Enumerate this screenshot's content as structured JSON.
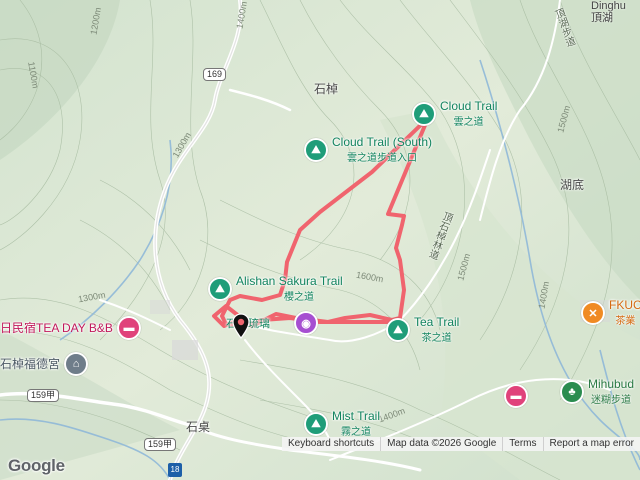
{
  "map": {
    "attribution": {
      "keyboard": "Keyboard shortcuts",
      "mapdata": "Map data ©2026 Google",
      "terms": "Terms",
      "report": "Report a map error"
    },
    "logo": "Google",
    "places": {
      "shizhao_top": "石棹",
      "shizhuo": "石桌",
      "hudi": "湖底",
      "dinghu": "Dinghu",
      "dinghu_zh": "頂湖"
    },
    "pois": {
      "cloud_trail": {
        "name": "Cloud Trail",
        "sub": "雲之道",
        "icon": "hiking-icon"
      },
      "cloud_trail_south": {
        "name": "Cloud Trail (South)",
        "sub": "雲之道步道入口",
        "icon": "hiking-icon"
      },
      "sakura_trail": {
        "name": "Alishan Sakura Trail",
        "sub": "櫻之道",
        "icon": "hiking-icon"
      },
      "tea_trail": {
        "name": "Tea Trail",
        "sub": "茶之道",
        "icon": "hiking-icon"
      },
      "mist_trail": {
        "name": "Mist Trail",
        "sub": "霧之道",
        "icon": "hiking-icon"
      },
      "bnb": {
        "name": "日民宿TEA DAY B&B",
        "icon": "lodging-icon"
      },
      "temple": {
        "name": "石棹福德宮",
        "icon": "temple-icon"
      },
      "camera": {
        "icon": "camera-icon"
      },
      "fkuc": {
        "name": "FKUC",
        "sub": "茶業",
        "icon": "food-icon"
      },
      "mihubud": {
        "name": "Mihubud",
        "sub": "迷糊步道",
        "icon": "park-icon"
      },
      "hotel": {
        "icon": "lodging-icon"
      },
      "liuli": {
        "name": "石棹琉璃"
      }
    },
    "roads": {
      "r169": "169",
      "r159a_1": "159甲",
      "r159a_2": "159甲",
      "r18": "18",
      "forest_road": "頂石棹林道",
      "dinghu_road": "頂湖步道"
    },
    "contours": {
      "c1400a": "1400m",
      "c1200": "1200m",
      "c1100": "1100m",
      "c1300a": "1300m",
      "c1300b": "1300m",
      "c1500a": "1500m",
      "c1500b": "1500m",
      "c1400b": "1400m",
      "c1400c": "1400m",
      "c1600": "1600m"
    },
    "colors": {
      "route": "#f0646e",
      "poi_green": "#1f9d79",
      "poi_pink": "#e0427b",
      "road": "#ffffff",
      "water": "#8fb8d8"
    }
  }
}
